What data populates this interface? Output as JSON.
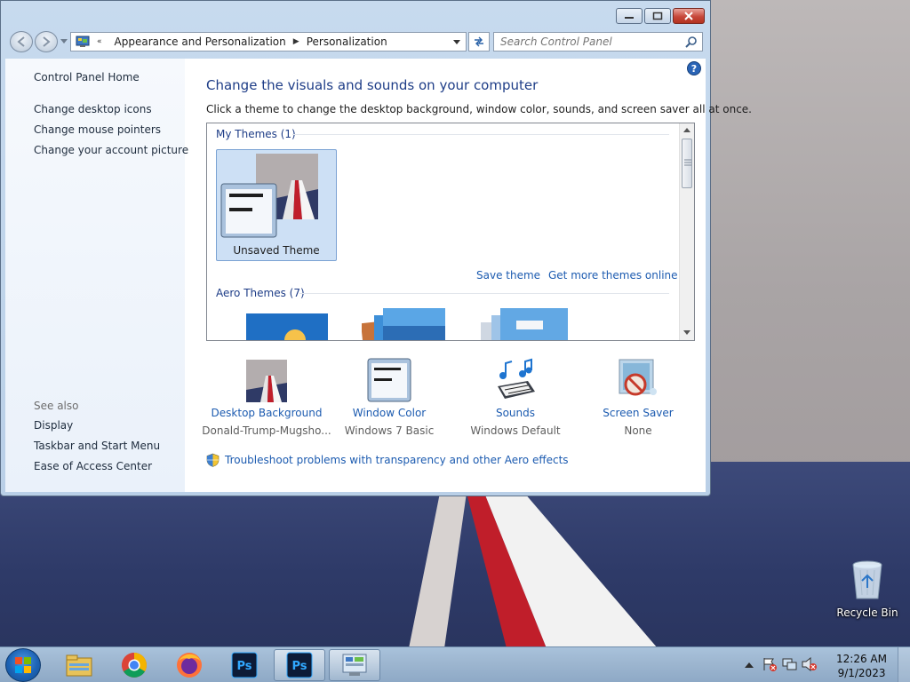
{
  "window": {
    "breadcrumb": [
      "Appearance and Personalization",
      "Personalization"
    ],
    "search_placeholder": "Search Control Panel"
  },
  "sidebar": {
    "home": "Control Panel Home",
    "links": [
      "Change desktop icons",
      "Change mouse pointers",
      "Change your account picture"
    ],
    "see_also_label": "See also",
    "see_also": [
      "Display",
      "Taskbar and Start Menu",
      "Ease of Access Center"
    ]
  },
  "main": {
    "title": "Change the visuals and sounds on your computer",
    "description": "Click a theme to change the desktop background, window color, sounds, and screen saver all at once.",
    "my_themes_header": "My Themes (1)",
    "unsaved_theme_label": "Unsaved Theme",
    "save_theme": "Save theme",
    "get_more_themes": "Get more themes online",
    "aero_themes_header": "Aero Themes (7)"
  },
  "settings": [
    {
      "label": "Desktop Background",
      "value": "Donald-Trump-Mugsho...",
      "icon": "desktop-background-icon"
    },
    {
      "label": "Window Color",
      "value": "Windows 7 Basic",
      "icon": "window-color-icon"
    },
    {
      "label": "Sounds",
      "value": "Windows Default",
      "icon": "sounds-icon"
    },
    {
      "label": "Screen Saver",
      "value": "None",
      "icon": "screen-saver-icon"
    }
  ],
  "troubleshoot": "Troubleshoot problems with transparency and other Aero effects",
  "desktop": {
    "recycle_bin": "Recycle Bin"
  },
  "taskbar": {
    "items": [
      "file-explorer-icon",
      "chrome-icon",
      "firefox-icon",
      "photoshop-icon",
      "photoshop-icon",
      "control-panel-icon"
    ],
    "clock_time": "12:26 AM",
    "clock_date": "9/1/2023"
  },
  "colors": {
    "link": "#1c5bb0",
    "title": "#1e3d87",
    "window_frame": "#b9cfe7",
    "taskbar": "#9db6d0"
  }
}
